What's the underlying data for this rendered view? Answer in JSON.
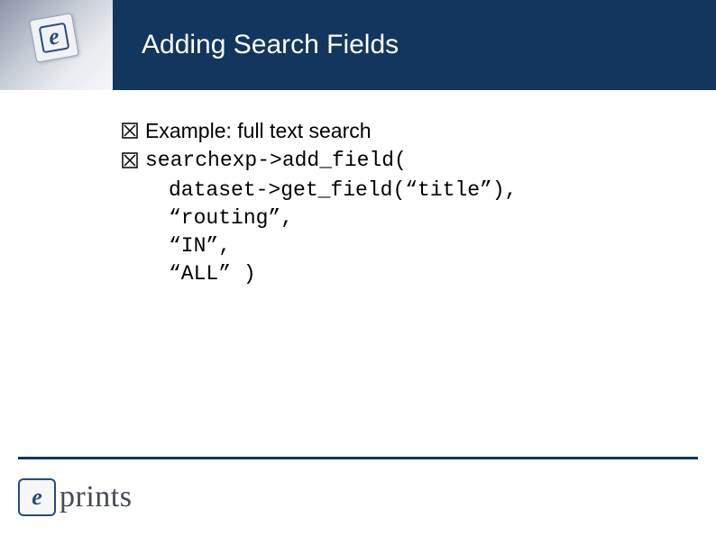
{
  "header": {
    "title": "Adding Search Fields"
  },
  "content": {
    "bullets": [
      {
        "text": "Example: full text search",
        "mono": false
      },
      {
        "text": "searchexp->add_field(",
        "mono": true
      }
    ],
    "code_lines": [
      "dataset->get_field(“title”),",
      "“routing”,",
      "“IN”,",
      "“ALL” )"
    ]
  },
  "footer": {
    "logo_text": "prints",
    "logo_letter": "e"
  },
  "corner": {
    "logo_letter": "e"
  }
}
